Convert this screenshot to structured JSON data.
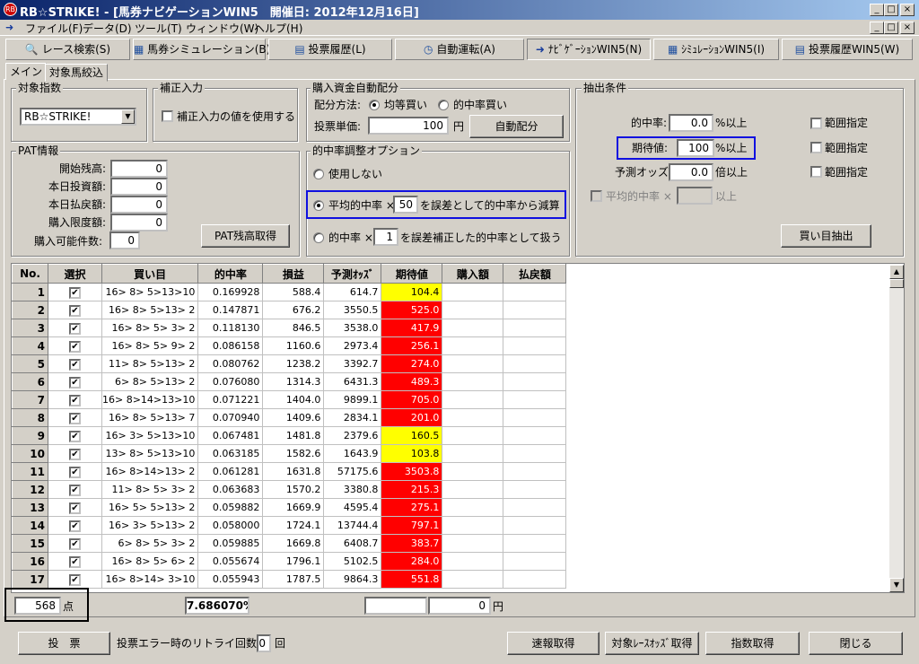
{
  "window": {
    "title": "RB☆STRIKE! - [馬券ナビゲーションWIN5　開催日: 2012年12月16日]",
    "icon_text": "RB",
    "min_label": "_",
    "max_label": "□",
    "close_label": "×"
  },
  "menu": [
    "ファイル(F)",
    "データ(D)",
    "ツール(T)",
    "ウィンドウ(W)",
    "ヘルプ(H)"
  ],
  "toolbar": [
    {
      "label": "レース検索(S)",
      "icon": "search-icon"
    },
    {
      "label": "馬券シミュレーション(B)",
      "icon": "grid-icon"
    },
    {
      "label": "投票履歴(L)",
      "icon": "document-icon"
    },
    {
      "label": "自動運転(A)",
      "icon": "clock-icon"
    },
    {
      "label": "ﾅﾋﾞｹﾞｰｼｮﾝWIN5(N)",
      "icon": "arrow-icon"
    },
    {
      "label": "ｼﾐｭﾚｰｼｮﾝWIN5(I)",
      "icon": "grid-icon"
    },
    {
      "label": "投票履歴WIN5(W)",
      "icon": "document-icon"
    }
  ],
  "tabs": [
    "メイン",
    "対象馬絞込"
  ],
  "target_index": {
    "title": "対象指数",
    "selected": "RB☆STRIKE!"
  },
  "correction": {
    "title": "補正入力",
    "checkbox_label": "補正入力の値を使用する"
  },
  "fund": {
    "title": "購入資金自動配分",
    "method_label": "配分方法:",
    "option_equal": "均等買い",
    "option_hit": "的中率買い",
    "unit_label": "投票単価:",
    "unit_value": "100",
    "unit_suffix": "円",
    "auto_button": "自動配分"
  },
  "pat": {
    "title": "PAT情報",
    "rows": [
      {
        "label": "開始残高:",
        "value": "0"
      },
      {
        "label": "本日投資額:",
        "value": "0"
      },
      {
        "label": "本日払戻額:",
        "value": "0"
      },
      {
        "label": "購入限度額:",
        "value": "0"
      }
    ],
    "count_label": "購入可能件数:",
    "count_value": "0",
    "fetch_button": "PAT残高取得"
  },
  "adjust": {
    "title": "的中率調整オプション",
    "opt_none": "使用しない",
    "opt_avg_prefix": "平均的中率 ×",
    "opt_avg_value": "50",
    "opt_avg_suffix": "を誤差として的中率から減算",
    "opt_hit_prefix": "的中率 ×",
    "opt_hit_value": "1",
    "opt_hit_suffix": "を誤差補正した的中率として扱う"
  },
  "extract": {
    "title": "抽出条件",
    "hit_label": "的中率:",
    "hit_value": "0.0",
    "hit_suffix": "%以上",
    "ev_label": "期待値:",
    "ev_value": "100",
    "ev_suffix": "%以上",
    "odds_label": "予測オッズ:",
    "odds_value": "0.0",
    "odds_suffix": "倍以上",
    "avg_label": "平均的中率 ×",
    "avg_suffix": "以上",
    "range_label": "範囲指定",
    "button": "買い目抽出"
  },
  "table": {
    "headers": [
      "No.",
      "選択",
      "買い目",
      "的中率",
      "損益",
      "予測ｵｯｽﾞ",
      "期待値",
      "購入額",
      "払戻額"
    ],
    "rows": [
      {
        "no": "1",
        "bet": "16> 8> 5>13>10",
        "hit": "0.169928",
        "pl": "588.4",
        "odds": "614.7",
        "ev": "104.4",
        "ev_color": "yellow"
      },
      {
        "no": "2",
        "bet": "16> 8> 5>13> 2",
        "hit": "0.147871",
        "pl": "676.2",
        "odds": "3550.5",
        "ev": "525.0",
        "ev_color": "red"
      },
      {
        "no": "3",
        "bet": "16> 8> 5> 3> 2",
        "hit": "0.118130",
        "pl": "846.5",
        "odds": "3538.0",
        "ev": "417.9",
        "ev_color": "red"
      },
      {
        "no": "4",
        "bet": "16> 8> 5> 9> 2",
        "hit": "0.086158",
        "pl": "1160.6",
        "odds": "2973.4",
        "ev": "256.1",
        "ev_color": "red"
      },
      {
        "no": "5",
        "bet": "11> 8> 5>13> 2",
        "hit": "0.080762",
        "pl": "1238.2",
        "odds": "3392.7",
        "ev": "274.0",
        "ev_color": "red"
      },
      {
        "no": "6",
        "bet": "6> 8> 5>13> 2",
        "hit": "0.076080",
        "pl": "1314.3",
        "odds": "6431.3",
        "ev": "489.3",
        "ev_color": "red"
      },
      {
        "no": "7",
        "bet": "16> 8>14>13>10",
        "hit": "0.071221",
        "pl": "1404.0",
        "odds": "9899.1",
        "ev": "705.0",
        "ev_color": "red"
      },
      {
        "no": "8",
        "bet": "16> 8> 5>13> 7",
        "hit": "0.070940",
        "pl": "1409.6",
        "odds": "2834.1",
        "ev": "201.0",
        "ev_color": "red"
      },
      {
        "no": "9",
        "bet": "16> 3> 5>13>10",
        "hit": "0.067481",
        "pl": "1481.8",
        "odds": "2379.6",
        "ev": "160.5",
        "ev_color": "yellow"
      },
      {
        "no": "10",
        "bet": "13> 8> 5>13>10",
        "hit": "0.063185",
        "pl": "1582.6",
        "odds": "1643.9",
        "ev": "103.8",
        "ev_color": "yellow"
      },
      {
        "no": "11",
        "bet": "16> 8>14>13> 2",
        "hit": "0.061281",
        "pl": "1631.8",
        "odds": "57175.6",
        "ev": "3503.8",
        "ev_color": "red"
      },
      {
        "no": "12",
        "bet": "11> 8> 5> 3> 2",
        "hit": "0.063683",
        "pl": "1570.2",
        "odds": "3380.8",
        "ev": "215.3",
        "ev_color": "red"
      },
      {
        "no": "13",
        "bet": "16> 5> 5>13> 2",
        "hit": "0.059882",
        "pl": "1669.9",
        "odds": "4595.4",
        "ev": "275.1",
        "ev_color": "red"
      },
      {
        "no": "14",
        "bet": "16> 3> 5>13> 2",
        "hit": "0.058000",
        "pl": "1724.1",
        "odds": "13744.4",
        "ev": "797.1",
        "ev_color": "red"
      },
      {
        "no": "15",
        "bet": "6> 8> 5> 3> 2",
        "hit": "0.059885",
        "pl": "1669.8",
        "odds": "6408.7",
        "ev": "383.7",
        "ev_color": "red"
      },
      {
        "no": "16",
        "bet": "16> 8> 5> 6> 2",
        "hit": "0.055674",
        "pl": "1796.1",
        "odds": "5102.5",
        "ev": "284.0",
        "ev_color": "red"
      },
      {
        "no": "17",
        "bet": "16> 8>14> 3>10",
        "hit": "0.055943",
        "pl": "1787.5",
        "odds": "9864.3",
        "ev": "551.8",
        "ev_color": "red"
      }
    ],
    "check_mark": "✔"
  },
  "status": {
    "count_value": "568",
    "count_unit": "点",
    "hit_total": "7.686070%",
    "amount_value": "0",
    "amount_unit": "円"
  },
  "bottom": {
    "vote_button": "投　票",
    "retry_label": "投票エラー時のリトライ回数:",
    "retry_value": "0",
    "retry_unit": "回",
    "quick_button": "速報取得",
    "odds_button": "対象ﾚｰｽｵｯｽﾞ取得",
    "index_button": "指数取得",
    "close_button": "閉じる"
  }
}
